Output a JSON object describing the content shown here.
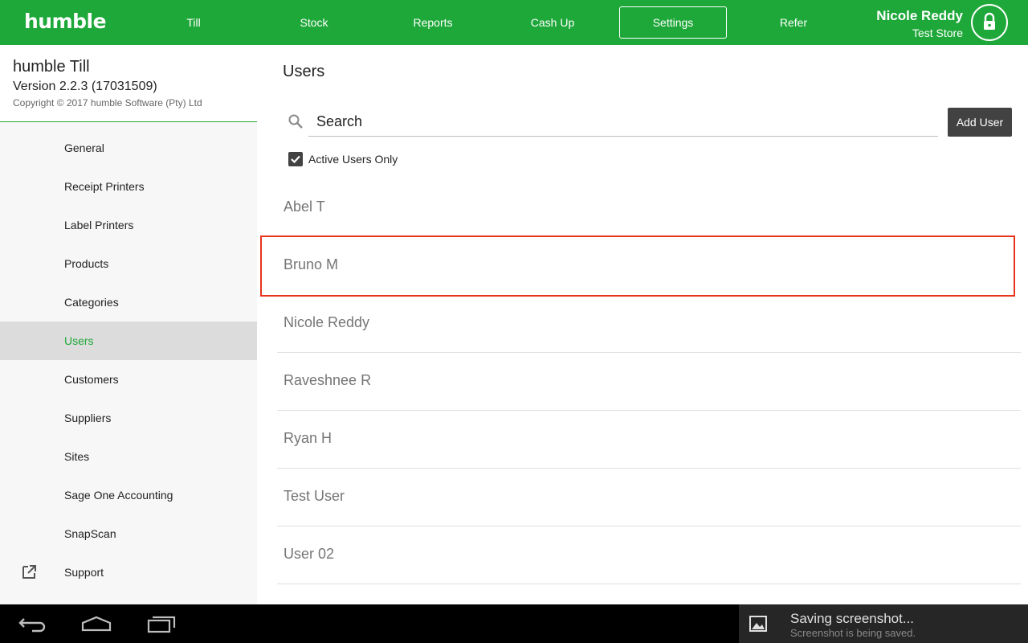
{
  "app": {
    "logo": "humble"
  },
  "nav": {
    "items": [
      {
        "label": "Till"
      },
      {
        "label": "Stock"
      },
      {
        "label": "Reports"
      },
      {
        "label": "Cash Up"
      },
      {
        "label": "Settings",
        "active": true
      },
      {
        "label": "Refer"
      }
    ]
  },
  "user": {
    "name": "Nicole Reddy",
    "store": "Test Store",
    "icon": "lock-icon"
  },
  "sidebar": {
    "title": "humble Till",
    "version": "Version 2.2.3 (17031509)",
    "copyright": "Copyright © 2017 humble Software (Pty) Ltd",
    "items": [
      {
        "label": "General"
      },
      {
        "label": "Receipt Printers"
      },
      {
        "label": "Label Printers"
      },
      {
        "label": "Products"
      },
      {
        "label": "Categories"
      },
      {
        "label": "Users",
        "selected": true
      },
      {
        "label": "Customers"
      },
      {
        "label": "Suppliers"
      },
      {
        "label": "Sites"
      },
      {
        "label": "Sage One Accounting"
      },
      {
        "label": "SnapScan"
      },
      {
        "label": "Support",
        "icon": "external-link-icon"
      }
    ]
  },
  "main": {
    "title": "Users",
    "search": {
      "placeholder": "Search",
      "value": ""
    },
    "add_user_label": "Add User",
    "active_only": {
      "label": "Active Users Only",
      "checked": true
    },
    "users": [
      "Abel T",
      "Bruno M",
      "Nicole Reddy",
      "Raveshnee R",
      "Ryan H",
      "Test User",
      "User 02"
    ],
    "highlighted_user": "Bruno M"
  },
  "toast": {
    "title": "Saving screenshot...",
    "subtitle": "Screenshot is being saved."
  },
  "colors": {
    "brand_green": "#1fa83a",
    "highlight_red": "#e8341c",
    "button_dark": "#424242"
  }
}
